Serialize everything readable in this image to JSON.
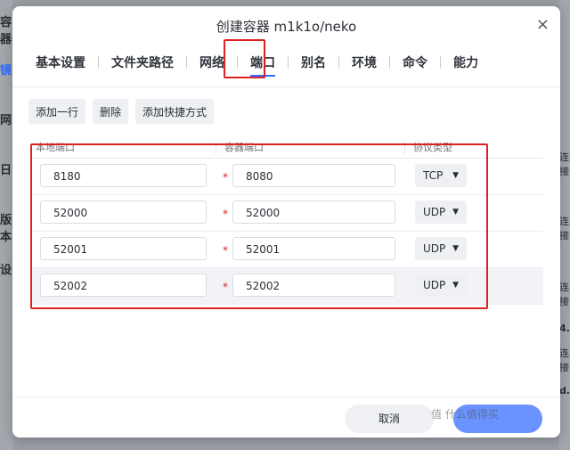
{
  "dialog": {
    "title": "创建容器 m1k1o/neko",
    "close_label": "×"
  },
  "tabs": [
    {
      "label": "基本设置"
    },
    {
      "label": "文件夹路径"
    },
    {
      "label": "网络"
    },
    {
      "label": "端口",
      "active": true
    },
    {
      "label": "别名"
    },
    {
      "label": "环境"
    },
    {
      "label": "命令"
    },
    {
      "label": "能力"
    }
  ],
  "actions": {
    "add_row": "添加一行",
    "delete": "删除",
    "add_shortcut": "添加快捷方式"
  },
  "table": {
    "headers": [
      "本地端口",
      "容器端口",
      "协议类型"
    ],
    "rows": [
      {
        "local": "8180",
        "container": "8080",
        "protocol": "TCP"
      },
      {
        "local": "52000",
        "container": "52000",
        "protocol": "UDP"
      },
      {
        "local": "52001",
        "container": "52001",
        "protocol": "UDP"
      },
      {
        "local": "52002",
        "container": "52002",
        "protocol": "UDP"
      }
    ],
    "required_mark": "*",
    "caret": "▼"
  },
  "footer": {
    "cancel": "取消"
  },
  "background": {
    "left_fragments": [
      "容器",
      "镜",
      "网",
      "日",
      "版本",
      "设"
    ],
    "right_fragments": [
      "连接",
      "连接",
      "连接",
      "连接",
      "4.",
      "d."
    ]
  },
  "watermark": "值 什么值得买",
  "colors": {
    "accent": "#2f6bff",
    "primary_button": "#6b93ff",
    "highlight": "#e02020"
  }
}
